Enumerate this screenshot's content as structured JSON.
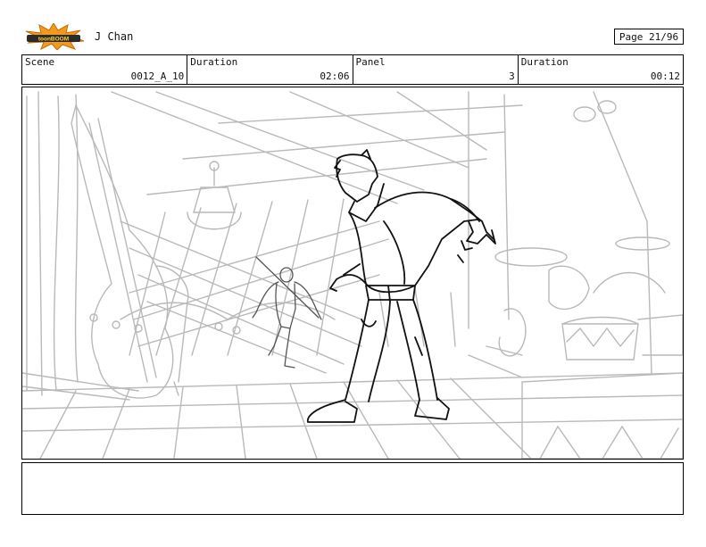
{
  "header": {
    "logo_text": "toonBOOM",
    "project": "J Chan",
    "page": "Page 21/96"
  },
  "info": {
    "scene_label": "Scene",
    "scene_value": "0012_A_10",
    "duration_label": "Duration",
    "duration_value": "02:06",
    "panel_label": "Panel",
    "panel_value": "3",
    "panel_duration_label": "Duration",
    "panel_duration_value": "00:12"
  },
  "notes": {
    "text": ""
  }
}
